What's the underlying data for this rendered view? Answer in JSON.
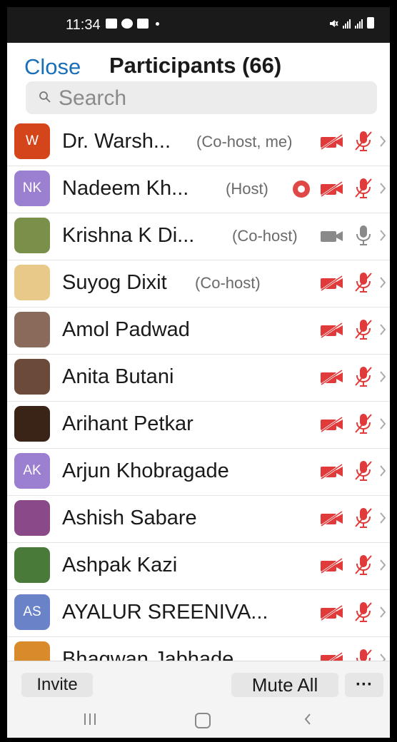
{
  "status_bar": {
    "time": "11:34"
  },
  "header": {
    "close_label": "Close",
    "title": "Participants (66)"
  },
  "search": {
    "placeholder": "Search"
  },
  "participants": [
    {
      "name": "Dr. Warsh...",
      "role": "(Co-host, me)",
      "initials": "W",
      "avatar_color": "#d4451b",
      "video_on": false,
      "audio_on": false,
      "recording": false
    },
    {
      "name": "Nadeem Kh...",
      "role": "(Host)",
      "initials": "NK",
      "avatar_color": "#9b7fd0",
      "video_on": false,
      "audio_on": false,
      "recording": true
    },
    {
      "name": "Krishna K Di...",
      "role": "(Co-host)",
      "initials": "",
      "avatar_color": "#7a8f4a",
      "video_on": true,
      "audio_on": true,
      "recording": false
    },
    {
      "name": "Suyog Dixit",
      "role": "(Co-host)",
      "initials": "",
      "avatar_color": "#e8c98a",
      "video_on": false,
      "audio_on": false,
      "recording": false
    },
    {
      "name": "Amol Padwad",
      "role": "",
      "initials": "",
      "avatar_color": "#8a6a5a",
      "video_on": false,
      "audio_on": false,
      "recording": false
    },
    {
      "name": "Anita Butani",
      "role": "",
      "initials": "",
      "avatar_color": "#6b4a3a",
      "video_on": false,
      "audio_on": false,
      "recording": false
    },
    {
      "name": "Arihant Petkar",
      "role": "",
      "initials": "",
      "avatar_color": "#3a2418",
      "video_on": false,
      "audio_on": false,
      "recording": false
    },
    {
      "name": "Arjun Khobragade",
      "role": "",
      "initials": "AK",
      "avatar_color": "#9b7fd0",
      "video_on": false,
      "audio_on": false,
      "recording": false
    },
    {
      "name": "Ashish Sabare",
      "role": "",
      "initials": "",
      "avatar_color": "#8a4a8a",
      "video_on": false,
      "audio_on": false,
      "recording": false
    },
    {
      "name": "Ashpak Kazi",
      "role": "",
      "initials": "",
      "avatar_color": "#4a7a3a",
      "video_on": false,
      "audio_on": false,
      "recording": false
    },
    {
      "name": "AYALUR SREENIVA...",
      "role": "",
      "initials": "AS",
      "avatar_color": "#6a82c8",
      "video_on": false,
      "audio_on": false,
      "recording": false
    },
    {
      "name": "Bhagwan Jabhade",
      "role": "",
      "initials": "",
      "avatar_color": "#d98a2a",
      "video_on": false,
      "audio_on": false,
      "recording": false
    }
  ],
  "footer": {
    "invite_label": "Invite",
    "mute_all_label": "Mute All",
    "more_label": "···"
  },
  "colors": {
    "accent": "#1a6fb9",
    "muted_red": "#e03a3a",
    "active_gray": "#8a8a8a"
  }
}
